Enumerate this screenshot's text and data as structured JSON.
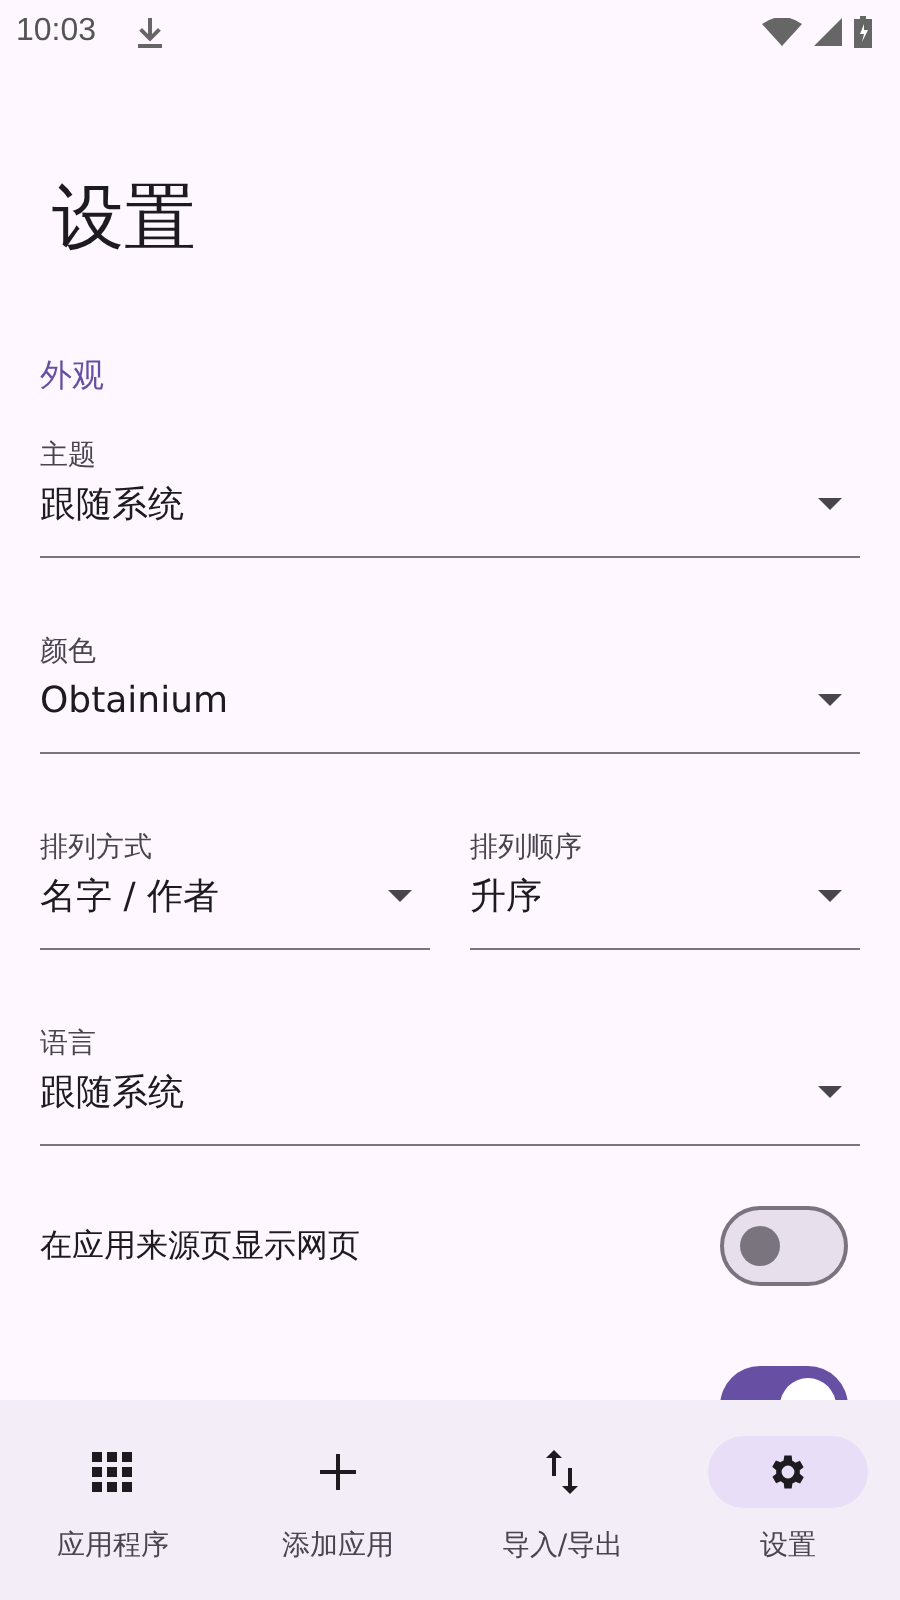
{
  "status_bar": {
    "time": "10:03"
  },
  "title": "设置",
  "section": "外观",
  "settings": [
    {
      "kind": "dropdown",
      "label": "主题",
      "value": "跟随系统"
    },
    {
      "kind": "dropdown",
      "label": "颜色",
      "value": "Obtainium"
    },
    {
      "kind": "dropdown_pair",
      "fields": [
        {
          "label": "排列方式",
          "value": "名字 / 作者"
        },
        {
          "label": "排列顺序",
          "value": "升序"
        }
      ]
    },
    {
      "kind": "dropdown",
      "label": "语言",
      "value": "跟随系统"
    },
    {
      "kind": "toggle",
      "label": "在应用来源页显示网页",
      "on": false
    },
    {
      "kind": "toggle",
      "on": true
    }
  ],
  "nav": [
    {
      "label": "应用程序",
      "kind": "apps",
      "selected": false
    },
    {
      "label": "添加应用",
      "kind": "add",
      "selected": false
    },
    {
      "label": "导入/导出",
      "kind": "transfer",
      "selected": false
    },
    {
      "label": "设置",
      "kind": "settings",
      "selected": true
    }
  ]
}
